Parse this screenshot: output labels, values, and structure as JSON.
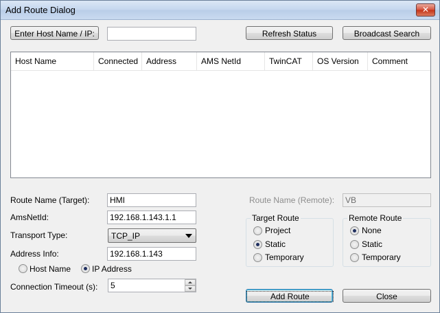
{
  "window": {
    "title": "Add Route Dialog",
    "close_glyph": "✕"
  },
  "top_bar": {
    "enter_host_button": "Enter Host Name / IP:",
    "host_input_value": "",
    "refresh_button": "Refresh Status",
    "broadcast_button": "Broadcast Search"
  },
  "list": {
    "columns": [
      "Host Name",
      "Connected",
      "Address",
      "AMS NetId",
      "TwinCAT",
      "OS Version",
      "Comment"
    ],
    "rows": []
  },
  "form": {
    "route_name_label": "Route Name (Target):",
    "route_name_value": "HMI",
    "amsnetid_label": "AmsNetId:",
    "amsnetid_value": "192.168.1.143.1.1",
    "transport_label": "Transport Type:",
    "transport_value": "TCP_IP",
    "address_label": "Address Info:",
    "address_value": "192.168.1.143",
    "address_mode": {
      "options": [
        "Host Name",
        "IP Address"
      ],
      "selected": "IP Address"
    },
    "timeout_label": "Connection Timeout (s):",
    "timeout_value": "5",
    "remote_name_label": "Route Name (Remote):",
    "remote_name_value": "VB"
  },
  "target_route": {
    "title": "Target Route",
    "options": [
      "Project",
      "Static",
      "Temporary"
    ],
    "selected": "Static"
  },
  "remote_route": {
    "title": "Remote Route",
    "options": [
      "None",
      "Static",
      "Temporary"
    ],
    "selected": "None"
  },
  "actions": {
    "add_route": "Add Route",
    "close": "Close"
  },
  "colors": {
    "window_bg": "#f0f0f0",
    "title_gradient_top": "#dbe7f5",
    "close_red": "#c43217",
    "default_button_border": "#3c7fb1"
  }
}
